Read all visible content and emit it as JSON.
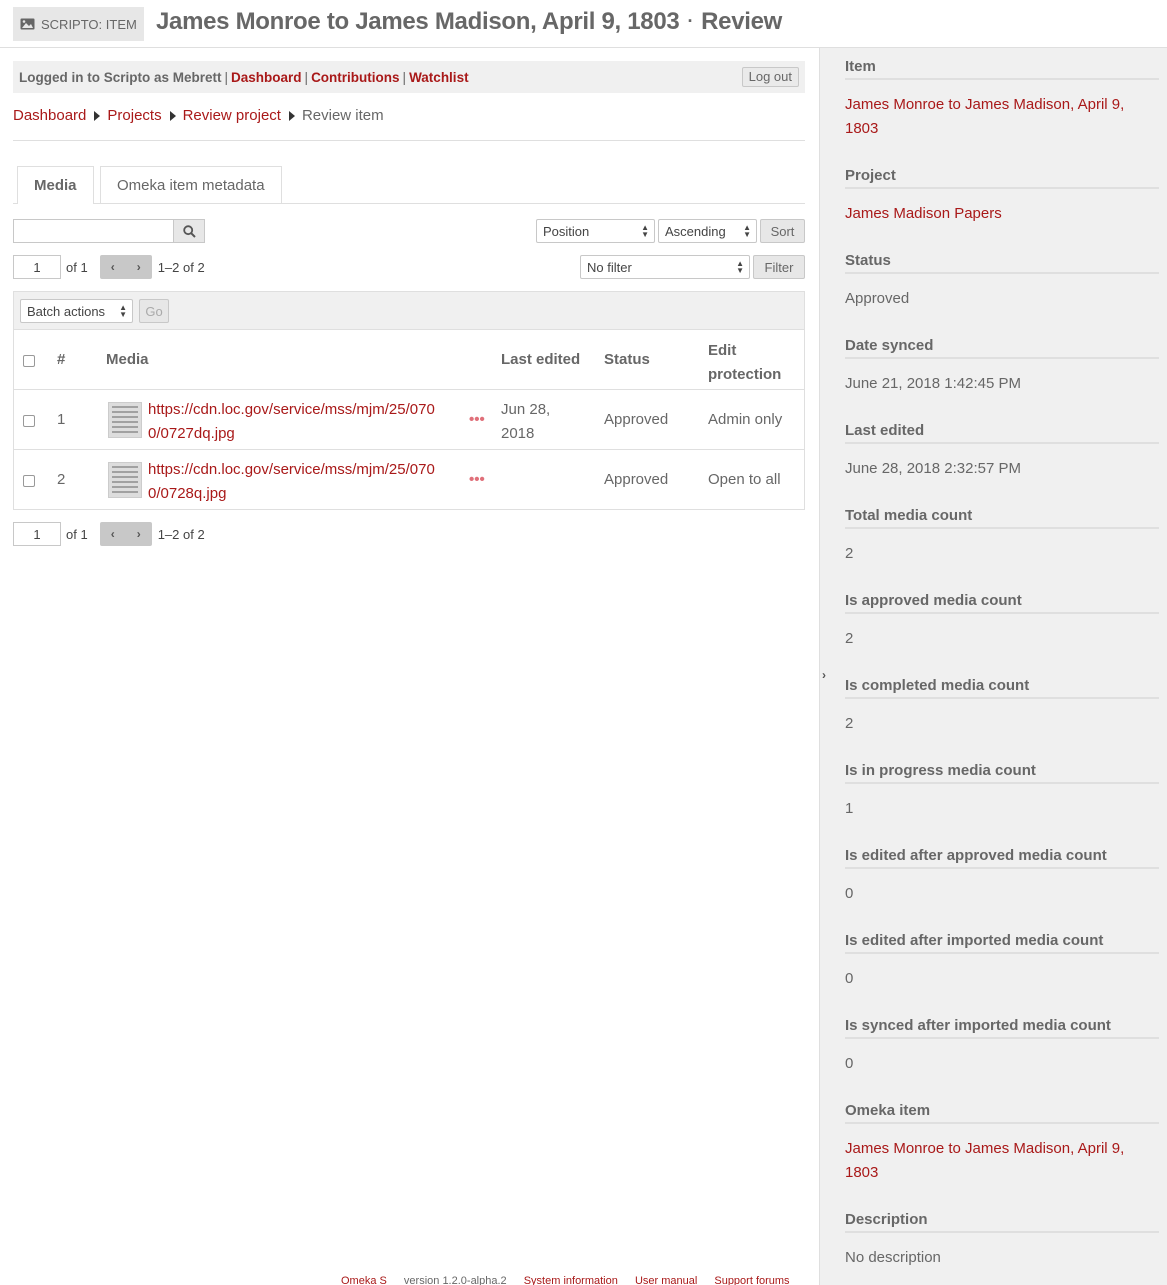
{
  "header": {
    "badge": "SCRIPTO: ITEM",
    "title": "James Monroe to James Madison, April 9, 1803",
    "separator": "·",
    "action": "Review"
  },
  "userbar": {
    "logged_in_text": "Logged in to Scripto as Mebrett",
    "links": [
      "Dashboard",
      "Contributions",
      "Watchlist"
    ],
    "logout": "Log out"
  },
  "breadcrumbs": [
    "Dashboard",
    "Projects",
    "Review project",
    "Review item"
  ],
  "tabs": [
    "Media",
    "Omeka item metadata"
  ],
  "search": {
    "value": "",
    "button_icon": "search-icon"
  },
  "sort": {
    "by": "Position",
    "order": "Ascending",
    "button": "Sort"
  },
  "filter": {
    "value": "No filter",
    "button": "Filter"
  },
  "pagination": {
    "page": "1",
    "of": "of 1",
    "range": "1–2 of 2"
  },
  "batch": {
    "label": "Batch actions",
    "go": "Go"
  },
  "table": {
    "headers": [
      "#",
      "Media",
      "Last edited",
      "Status",
      "Edit",
      "protection"
    ],
    "rows": [
      {
        "num": "1",
        "url_line1": "https://cdn.loc.gov/service/mss/mjm/25/070",
        "url_line2": "0/0727dq.jpg",
        "more": "•••",
        "edited_line1": "Jun 28,",
        "edited_line2": "2018",
        "status": "Approved",
        "protection": "Admin only"
      },
      {
        "num": "2",
        "url_line1": "https://cdn.loc.gov/service/mss/mjm/25/070",
        "url_line2": "0/0728q.jpg",
        "more": "•••",
        "edited_line1": "",
        "edited_line2": "",
        "status": "Approved",
        "protection": "Open to all"
      }
    ]
  },
  "footer": [
    "Omeka S",
    "version 1.2.0-alpha.2",
    "System information",
    "User manual",
    "Support forums"
  ],
  "sidebar": {
    "toggle": "›",
    "sections": [
      {
        "label": "Item",
        "line1": "James Monroe to James Madison, April 9,",
        "line2": "1803"
      },
      {
        "label": "Project",
        "line1": "James Madison Papers"
      },
      {
        "label": "Status",
        "line1": "Approved"
      },
      {
        "label": "Date synced",
        "line1": "June 21, 2018 1:42:45 PM"
      },
      {
        "label": "Last edited",
        "line1": "June 28, 2018 2:32:57 PM"
      },
      {
        "label": "Total media count",
        "line1": "2"
      },
      {
        "label": "Is approved media count",
        "line1": "2"
      },
      {
        "label": "Is completed media count",
        "line1": "2"
      },
      {
        "label": "Is in progress media count",
        "line1": "1"
      },
      {
        "label": "Is edited after approved media count",
        "line1": "0"
      },
      {
        "label": "Is edited after imported media count",
        "line1": "0"
      },
      {
        "label": "Is synced after imported media count",
        "line1": "0"
      },
      {
        "label": "Omeka item",
        "line1": "James Monroe to James Madison, April 9,",
        "line2": "1803"
      },
      {
        "label": "Description",
        "line1": "No description"
      }
    ]
  },
  "colors": {
    "link": "#a91919",
    "text": "#676767",
    "panel": "#f0f0f0",
    "dots": "#e0707a"
  }
}
